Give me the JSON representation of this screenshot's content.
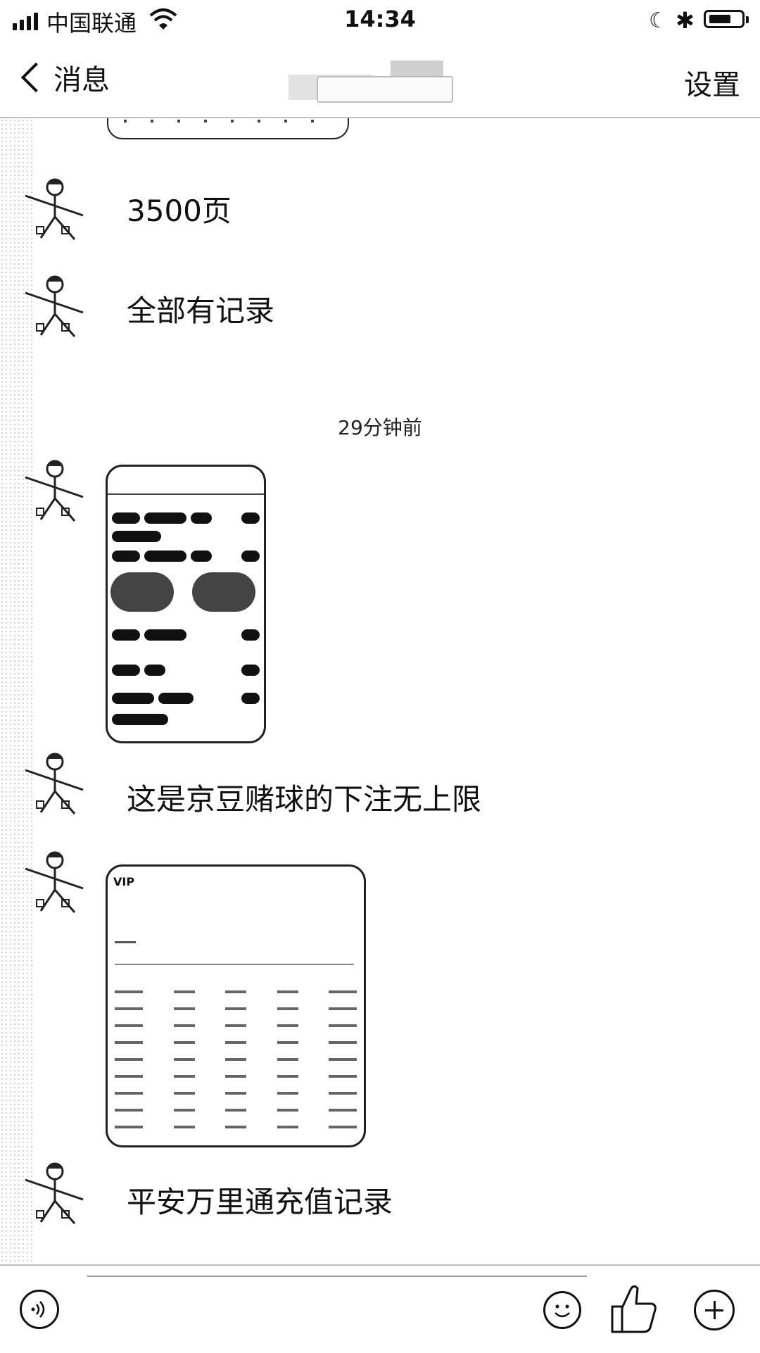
{
  "status_bar": {
    "carrier": "中国联通",
    "time": "14:34",
    "icons": [
      "signal-icon",
      "wifi-icon",
      "moon-icon",
      "bluetooth-icon",
      "battery-icon"
    ]
  },
  "nav": {
    "back_label": "消息",
    "settings_label": "设置"
  },
  "chat": {
    "messages": [
      {
        "type": "text",
        "text": "3500页"
      },
      {
        "type": "text",
        "text": "全部有记录"
      },
      {
        "type": "timestamp",
        "text": "29分钟前"
      },
      {
        "type": "image",
        "content": "phone-screenshot"
      },
      {
        "type": "text",
        "text": "这是京豆赌球的下注无上限"
      },
      {
        "type": "image",
        "content": "table-screenshot",
        "logo": "VIP"
      },
      {
        "type": "text",
        "text": "平安万里通充值记录"
      }
    ]
  },
  "toolbar": {
    "icons": [
      "voice-icon",
      "emoji-icon",
      "thumbs-up-icon",
      "plus-icon"
    ]
  }
}
